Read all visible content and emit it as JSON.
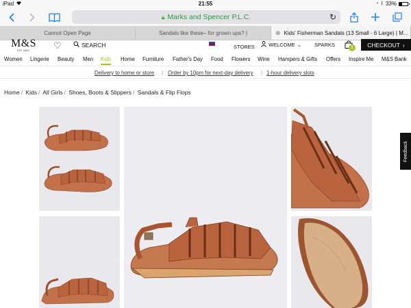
{
  "status_bar": {
    "device": "iPad",
    "time": "21:55",
    "battery": "33%"
  },
  "toolbar": {
    "url_title": "Marks and Spencer P.L.C."
  },
  "tabs": [
    {
      "title": "Cannot Open Page"
    },
    {
      "title": "Sandals like these– for grown ups? |"
    },
    {
      "title": "Kids' Fisherman Sandals (13 Small - 6 Large) | M..."
    }
  ],
  "header": {
    "logo": "M&S",
    "logo_est": "EST 1884",
    "search_label": "SEARCH",
    "stores_label": "STORES",
    "welcome_label": "WELCOME",
    "sparks_label": "SPARKS",
    "bag_count": "1",
    "checkout_label": "CHECKOUT"
  },
  "nav": {
    "items": [
      "Women",
      "Lingerie",
      "Beauty",
      "Men",
      "Kids",
      "Home",
      "Furniture",
      "Father's Day",
      "Food",
      "Flowers",
      "Wine",
      "Hampers & Gifts",
      "Offers",
      "Inspire Me",
      "M&S Bank"
    ],
    "active": "Kids"
  },
  "delivery": {
    "links": [
      "Delivery to home or store",
      "Order by 10pm for next-day delivery",
      "1-hour delivery slots"
    ]
  },
  "breadcrumb": [
    "Home",
    "Kids",
    "All Girls",
    "Shoes, Boots & Slippers",
    "Sandals & Flip Flops"
  ],
  "feedback_label": "Feedback",
  "colors": {
    "accent": "#a6c32a",
    "sandal_tan": "#b9643f",
    "photo_bg": "#e9e8ed"
  },
  "icons": [
    "back-icon",
    "forward-icon",
    "bookmarks-icon",
    "lock-icon",
    "reload-icon",
    "share-icon",
    "new-tab-icon",
    "tabs-icon",
    "heart-icon",
    "search-icon",
    "flag-icon",
    "user-icon",
    "bag-icon"
  ]
}
